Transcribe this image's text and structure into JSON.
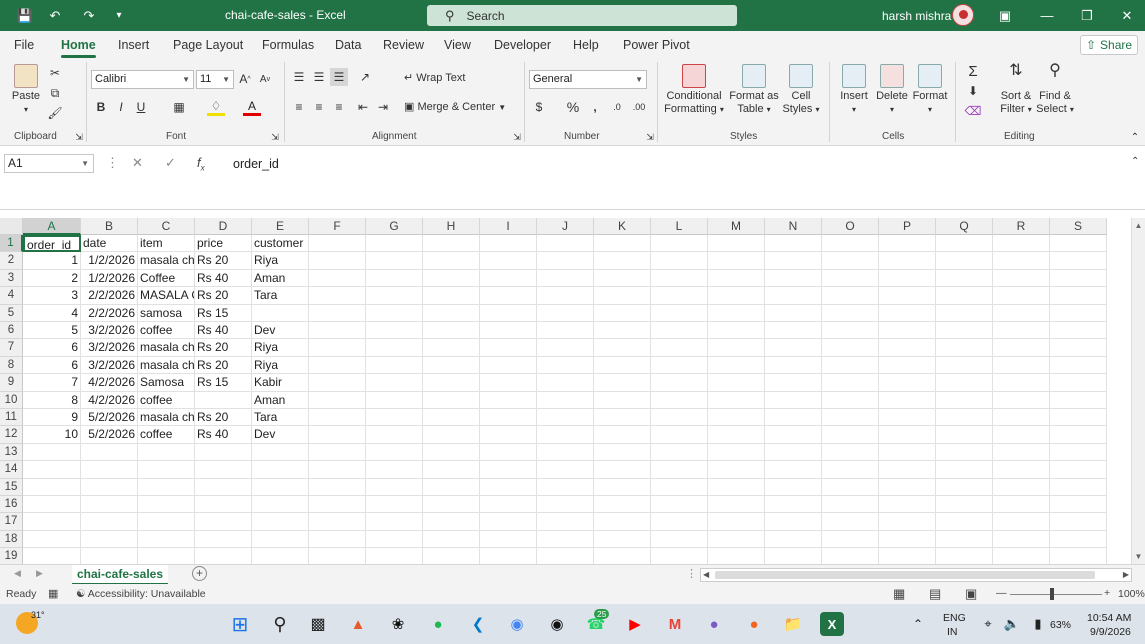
{
  "titlebar": {
    "document_title": "chai-cafe-sales  -  Excel",
    "search_placeholder": "Search",
    "user_name": "harsh mishra"
  },
  "ribbon_tabs": [
    "File",
    "Home",
    "Insert",
    "Page Layout",
    "Formulas",
    "Data",
    "Review",
    "View",
    "Developer",
    "Help",
    "Power Pivot"
  ],
  "active_tab": "Home",
  "share_label": "Share",
  "ribbon": {
    "clipboard": {
      "paste": "Paste",
      "label": "Clipboard"
    },
    "font": {
      "name": "Calibri",
      "size": "11",
      "label": "Font"
    },
    "alignment": {
      "wrap": "Wrap Text",
      "merge": "Merge & Center",
      "label": "Alignment"
    },
    "number": {
      "format": "General",
      "label": "Number"
    },
    "styles": {
      "conditional": "Conditional",
      "conditional2": "Formatting",
      "format_table": "Format as",
      "format_table2": "Table",
      "cell_styles": "Cell",
      "cell_styles2": "Styles",
      "label": "Styles"
    },
    "cells": {
      "insert": "Insert",
      "delete": "Delete",
      "format": "Format",
      "label": "Cells"
    },
    "editing": {
      "sort": "Sort &",
      "sort2": "Filter",
      "find": "Find &",
      "find2": "Select",
      "label": "Editing"
    }
  },
  "formula_bar": {
    "name_box": "A1",
    "content": "order_id"
  },
  "columns": [
    "A",
    "B",
    "C",
    "D",
    "E",
    "F",
    "G",
    "H",
    "I",
    "J",
    "K",
    "L",
    "M",
    "N",
    "O",
    "P",
    "Q",
    "R",
    "S"
  ],
  "rows": [
    "1",
    "2",
    "3",
    "4",
    "5",
    "6",
    "7",
    "8",
    "9",
    "10",
    "11",
    "12",
    "13",
    "14",
    "15",
    "16",
    "17",
    "18",
    "19"
  ],
  "sheet": {
    "header": [
      "order_id",
      "date",
      "item",
      "price",
      "customer"
    ],
    "data": [
      [
        "1",
        "1/2/2026",
        "masala ch",
        "Rs 20",
        "Riya"
      ],
      [
        "2",
        "1/2/2026",
        " Coffee",
        "Rs 40",
        "Aman"
      ],
      [
        "3",
        "2/2/2026",
        "MASALA C",
        "Rs 20",
        "Tara"
      ],
      [
        "4",
        "2/2/2026",
        "samosa",
        "Rs 15",
        ""
      ],
      [
        "5",
        "3/2/2026",
        "coffee",
        "Rs 40",
        "Dev"
      ],
      [
        "6",
        "3/2/2026",
        "masala ch",
        "Rs 20",
        "Riya"
      ],
      [
        "6",
        "3/2/2026",
        "masala ch",
        "Rs 20",
        "Riya"
      ],
      [
        "7",
        "4/2/2026",
        "  Samosa",
        "Rs 15",
        "Kabir"
      ],
      [
        "8",
        "4/2/2026",
        "coffee",
        "",
        "Aman"
      ],
      [
        "9",
        "5/2/2026",
        "masala ch",
        "Rs 20",
        "Tara"
      ],
      [
        "10",
        "5/2/2026",
        "coffee",
        "Rs 40",
        "Dev"
      ]
    ]
  },
  "sheet_tab": "chai-cafe-sales",
  "status": {
    "ready": "Ready",
    "accessibility": "Accessibility: Unavailable",
    "zoom": "100%"
  },
  "taskbar": {
    "weather": "31°",
    "badge": "25",
    "lang": "ENG",
    "lang2": "IN",
    "battery": "63%",
    "time": "10:54 AM",
    "date": "9/9/2026"
  },
  "colors": {
    "excel_green": "#217346",
    "titlebar": "#217346"
  }
}
